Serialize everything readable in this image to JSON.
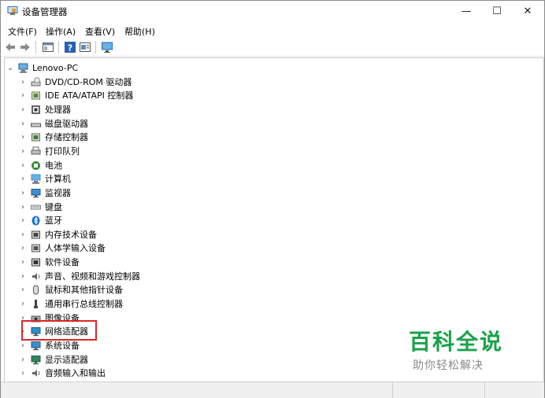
{
  "window": {
    "title": "设备管理器",
    "minimize_glyph": "—",
    "maximize_glyph": "☐",
    "close_glyph": "✕"
  },
  "menu": [
    "文件(F)",
    "操作(A)",
    "查看(V)",
    "帮助(H)"
  ],
  "toolbar": {
    "buttons": [
      "back-arrow-icon",
      "forward-arrow-icon",
      "properties-icon",
      "help-icon",
      "details-icon",
      "monitor-icon"
    ]
  },
  "tree": {
    "root": {
      "label": "Lenovo-PC",
      "expanded": true,
      "icon": "computer-icon"
    },
    "items": [
      {
        "label": "DVD/CD-ROM 驱动器",
        "icon": "dvd-drive-icon",
        "color": "#8a8a8a"
      },
      {
        "label": "IDE ATA/ATAPI 控制器",
        "icon": "ide-controller-icon",
        "color": "#5a8a3a"
      },
      {
        "label": "处理器",
        "icon": "processor-icon",
        "color": "#333333"
      },
      {
        "label": "磁盘驱动器",
        "icon": "disk-drive-icon",
        "color": "#555555"
      },
      {
        "label": "存储控制器",
        "icon": "storage-controller-icon",
        "color": "#4a7a3a"
      },
      {
        "label": "打印队列",
        "icon": "printer-icon",
        "color": "#666666"
      },
      {
        "label": "电池",
        "icon": "battery-icon",
        "color": "#3a8a3a"
      },
      {
        "label": "计算机",
        "icon": "computer-icon",
        "color": "#3a8fd0"
      },
      {
        "label": "监视器",
        "icon": "monitor-icon",
        "color": "#3a8fd0"
      },
      {
        "label": "键盘",
        "icon": "keyboard-icon",
        "color": "#888888"
      },
      {
        "label": "蓝牙",
        "icon": "bluetooth-icon",
        "color": "#1a6fd0"
      },
      {
        "label": "内存技术设备",
        "icon": "memory-device-icon",
        "color": "#444444"
      },
      {
        "label": "人体学输入设备",
        "icon": "hid-icon",
        "color": "#555555"
      },
      {
        "label": "软件设备",
        "icon": "software-device-icon",
        "color": "#333333"
      },
      {
        "label": "声音、视频和游戏控制器",
        "icon": "speaker-icon",
        "color": "#666666"
      },
      {
        "label": "鼠标和其他指针设备",
        "icon": "mouse-icon",
        "color": "#555555"
      },
      {
        "label": "通用串行总线控制器",
        "icon": "usb-icon",
        "color": "#444444"
      },
      {
        "label": "图像设备",
        "icon": "camera-icon",
        "color": "#555555"
      },
      {
        "label": "网络适配器",
        "icon": "network-adapter-icon",
        "color": "#2a8fd0"
      },
      {
        "label": "系统设备",
        "icon": "system-device-icon",
        "color": "#3a8fd0"
      },
      {
        "label": "显示适配器",
        "icon": "display-adapter-icon",
        "color": "#2a8a4a"
      },
      {
        "label": "音频输入和输出",
        "icon": "audio-io-icon",
        "color": "#666666"
      }
    ],
    "highlighted": "网络适配器",
    "highlight_color": "#e0262b"
  },
  "watermark": {
    "title": "百科全说",
    "subtitle": "助你轻松解决",
    "title_color": "#1aa24a"
  }
}
